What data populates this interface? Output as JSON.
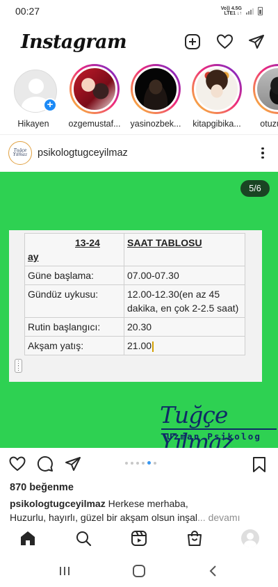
{
  "status_bar": {
    "time": "00:27",
    "network_line1": "Vo)) 4.5G",
    "network_line2": "LTE1 ↓↑"
  },
  "header": {
    "logo": "Instagram",
    "icons": [
      "new-post-icon",
      "heart-icon",
      "direct-message-icon"
    ]
  },
  "stories": [
    {
      "label": "Hikayen",
      "own": true
    },
    {
      "label": "ozgemustaf...",
      "own": false
    },
    {
      "label": "yasinozbek...",
      "own": false
    },
    {
      "label": "kitapgibika...",
      "own": false
    },
    {
      "label": "otuzunda",
      "own": false
    }
  ],
  "post": {
    "username": "psikologtugceyilmaz",
    "avatar_text": "Tuğçe Yılmaz",
    "counter": "5/6",
    "table": {
      "header_left_top": "13-24",
      "header_left_bottom": "ay",
      "header_right": "SAAT TABLOSU",
      "rows": [
        {
          "label": "Güne başlama:",
          "value": "07.00-07.30"
        },
        {
          "label": "Gündüz uykusu:",
          "value": "12.00-12.30(en az 45 dakika, en çok 2-2.5 saat)"
        },
        {
          "label": "Rutin başlangıcı:",
          "value": "20.30"
        },
        {
          "label": "Akşam yatış:",
          "value": "21.00"
        }
      ]
    },
    "signature": "Tuğçe Yılmaz",
    "signature_sub": "Uzman Psikolog",
    "carousel_total": 6,
    "carousel_active": 5,
    "likes": "870 beğenme",
    "caption_user": "psikologtugceyilmaz",
    "caption_text_1": " Herkese merhaba,",
    "caption_text_2": "Huzurlu, hayırlı, güzel bir akşam olsun inşal",
    "caption_more": "... devamı"
  },
  "bottom_nav": [
    "home-icon",
    "search-icon",
    "reels-icon",
    "shop-icon",
    "profile-avatar"
  ],
  "colors": {
    "post_bg": "#2ed152",
    "signature": "#0f2a66",
    "accent_blue": "#3897f0"
  }
}
